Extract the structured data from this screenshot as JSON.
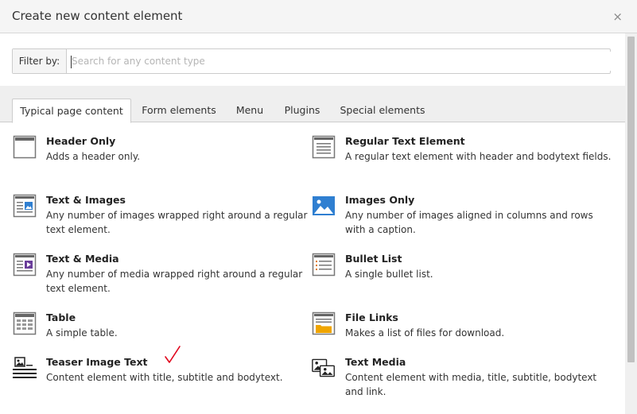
{
  "dialog": {
    "title": "Create new content element",
    "close_glyph": "×"
  },
  "filter": {
    "label": "Filter by:",
    "placeholder": "Search for any content type",
    "value": ""
  },
  "tabs": [
    {
      "label": "Typical page content",
      "active": true
    },
    {
      "label": "Form elements",
      "active": false
    },
    {
      "label": "Menu",
      "active": false
    },
    {
      "label": "Plugins",
      "active": false
    },
    {
      "label": "Special elements",
      "active": false
    }
  ],
  "items": [
    {
      "title": "Header Only",
      "desc": "Adds a header only.",
      "icon": "header-icon"
    },
    {
      "title": "Regular Text Element",
      "desc": "A regular text element with header and bodytext fields.",
      "icon": "text-icon"
    },
    {
      "title": "Text & Images",
      "desc": "Any number of images wrapped right around a regular text element.",
      "icon": "text-image-icon"
    },
    {
      "title": "Images Only",
      "desc": "Any number of images aligned in columns and rows with a caption.",
      "icon": "images-icon"
    },
    {
      "title": "Text & Media",
      "desc": "Any number of media wrapped right around a regular text element.",
      "icon": "text-media-icon"
    },
    {
      "title": "Bullet List",
      "desc": "A single bullet list.",
      "icon": "bullet-list-icon"
    },
    {
      "title": "Table",
      "desc": "A simple table.",
      "icon": "table-icon"
    },
    {
      "title": "File Links",
      "desc": "Makes a list of files for download.",
      "icon": "file-links-icon"
    },
    {
      "title": "Teaser Image Text",
      "desc": "Content element with title, subtitle and bodytext.",
      "icon": "teaser-image-text-icon"
    },
    {
      "title": "Text Media",
      "desc": "Content element with media, title, subtitle, bodytext and link.",
      "icon": "text-media-custom-icon"
    }
  ],
  "colors": {
    "header_bg": "#f5f5f5",
    "tabs_bg": "#efefef",
    "icon_blue": "#2f7fd1",
    "icon_purple": "#6a3d9a",
    "check_red": "#e0001a"
  }
}
